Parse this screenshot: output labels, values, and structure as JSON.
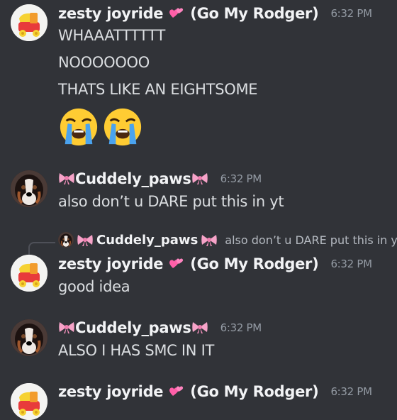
{
  "messages": [
    {
      "author": "zesty joyride",
      "author_suffix": "(Go My Rodger)",
      "time": "6:32 PM",
      "lines": [
        "WHAAATTTTTT",
        "NOOOOOOO",
        "THATS LIKE AN EIGHTSOME"
      ],
      "emojis": [
        "crying-face",
        "crying-face"
      ]
    },
    {
      "author": "Cuddely_paws",
      "time": "6:32 PM",
      "lines": [
        "also don’t u DARE put this in yt"
      ]
    },
    {
      "reply": {
        "author": "Cuddely_paws",
        "text": "also don’t u DARE put this in yt"
      },
      "author": "zesty joyride",
      "author_suffix": "(Go My Rodger)",
      "time": "6:32 PM",
      "lines": [
        "good idea"
      ]
    },
    {
      "author": "Cuddely_paws",
      "time": "6:32 PM",
      "lines": [
        "ALSO I HAS SMC IN IT"
      ]
    },
    {
      "author": "zesty joyride",
      "author_suffix": "(Go My Rodger)",
      "time": "6:32 PM"
    }
  ],
  "icons": {
    "heart": "two-hearts-icon",
    "bow": "ribbon-bow-icon",
    "crying": "loudly-crying-face-icon"
  },
  "colors": {
    "background": "#313338",
    "name": "#f2f3f5",
    "text": "#dbdee1",
    "timestamp": "#949ba4"
  }
}
